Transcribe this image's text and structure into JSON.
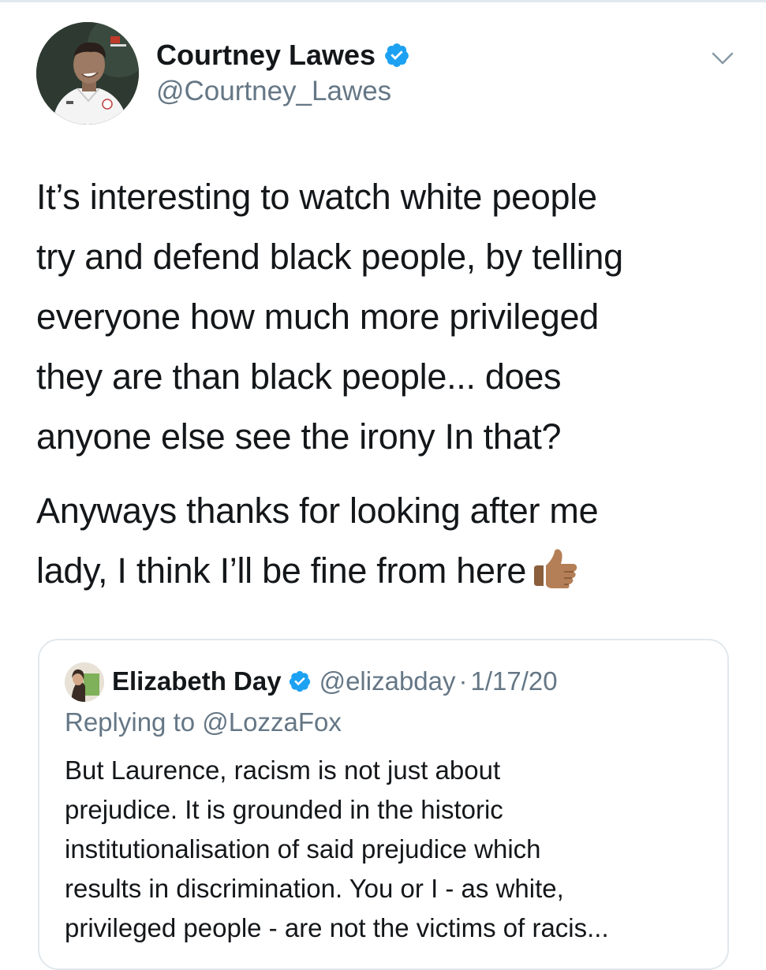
{
  "tweet": {
    "author": {
      "display_name": "Courtney Lawes",
      "handle": "@Courtney_Lawes",
      "verified": true,
      "avatar_icon": "player-avatar"
    },
    "menu_icon": "chevron-down-icon",
    "paragraphs": [
      "It’s interesting to watch white people\ntry and defend black people, by telling\neveryone how much more privileged\nthey are than black people... does\nanyone else see the irony In that?",
      "Anyways thanks for looking after me\nlady, I think I’ll be fine from here"
    ],
    "emoji": "thumbs-up-icon"
  },
  "quoted_tweet": {
    "author": {
      "display_name": "Elizabeth Day",
      "handle": "@elizabday",
      "verified": true
    },
    "separator": "·",
    "date": "1/17/20",
    "replying_label": "Replying to",
    "replying_handle": "@LozzaFox",
    "text": "But Laurence, racism is not just about\nprejudice. It is grounded in the historic\ninstitutionalisation of said prejudice which\nresults in discrimination. You or I - as white,\nprivileged people - are not the victims of racis..."
  },
  "colors": {
    "text_primary": "#14171a",
    "text_secondary": "#657786",
    "verified_blue": "#1da1f2",
    "border": "#e1e8ed"
  }
}
